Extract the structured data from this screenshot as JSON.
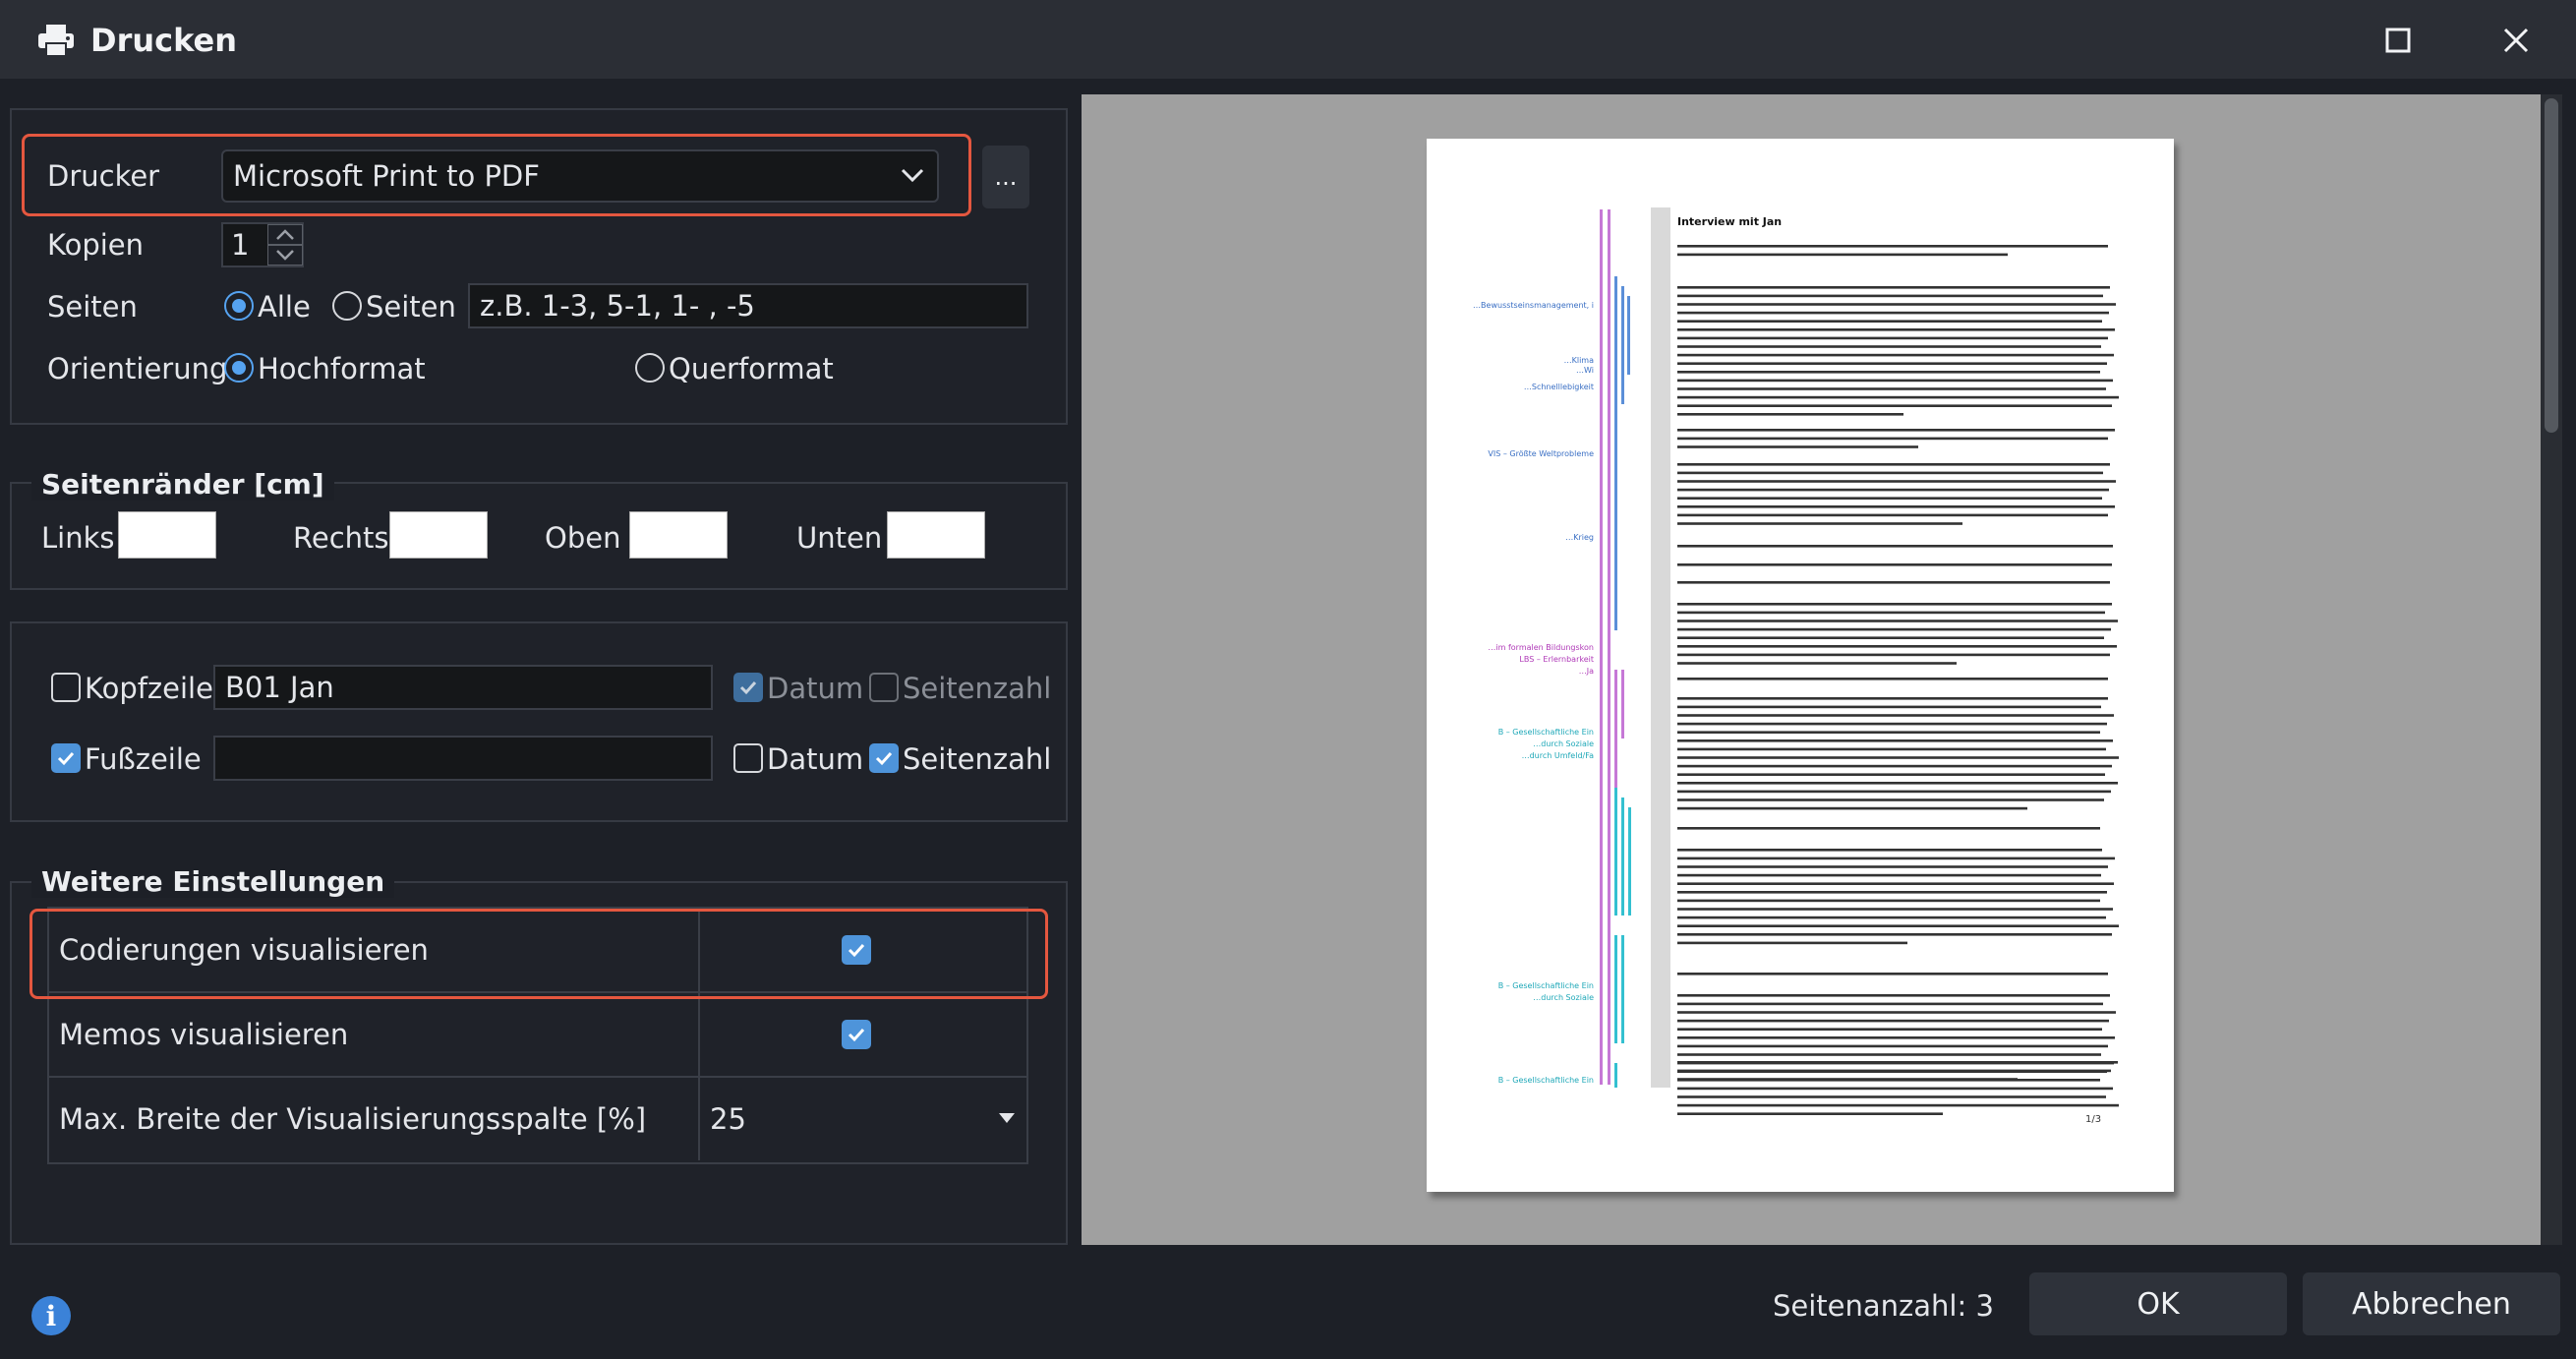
{
  "window": {
    "title": "Drucken",
    "title_icon": "printer-icon",
    "buttons": {
      "maximize_icon": "maximize-icon",
      "close_icon": "close-icon"
    }
  },
  "printer": {
    "label": "Drucker",
    "selected": "Microsoft Print to PDF",
    "more_label": "...",
    "copies_label": "Kopien",
    "copies_value": "1",
    "pages_label": "Seiten",
    "pages_all_label": "Alle",
    "pages_range_label": "Seiten",
    "pages_range_placeholder": "z.B. 1-3, 5-1, 1- , -5",
    "pages_selected": "all",
    "orientation_label": "Orientierung",
    "portrait_label": "Hochformat",
    "landscape_label": "Querformat",
    "orientation_selected": "portrait"
  },
  "margins": {
    "title": "Seitenränder [cm]",
    "left_label": "Links",
    "right_label": "Rechts",
    "top_label": "Oben",
    "bottom_label": "Unten"
  },
  "header_footer": {
    "header_label": "Kopfzeile",
    "header_checked": false,
    "header_value": "B01 Jan",
    "header_date_label": "Datum",
    "header_date_checked": true,
    "header_pagenum_label": "Seitenzahl",
    "header_pagenum_checked": false,
    "footer_label": "Fußzeile",
    "footer_checked": true,
    "footer_value": "",
    "footer_date_label": "Datum",
    "footer_date_checked": false,
    "footer_pagenum_label": "Seitenzahl",
    "footer_pagenum_checked": true
  },
  "settings": {
    "title": "Weitere Einstellungen",
    "rows": [
      {
        "label": "Codierungen visualisieren",
        "checked": true
      },
      {
        "label": "Memos visualisieren",
        "checked": true
      },
      {
        "label": "Max. Breite der Visualisierungsspalte [%]",
        "value": "25"
      }
    ]
  },
  "preview": {
    "page_title": "Interview mit Jan",
    "page_footer": "1/3",
    "code_labels": [
      {
        "text": "…Bewusstseinsmanagement, i",
        "color": "#3a6fc4"
      },
      {
        "text": "…Klima",
        "color": "#3a6fc4"
      },
      {
        "text": "…Wi",
        "color": "#3a6fc4"
      },
      {
        "text": "…Schnelllebigkeit",
        "color": "#3a6fc4"
      },
      {
        "text": "VIS – Größte Weltprobleme",
        "color": "#3a6fc4"
      },
      {
        "text": "…Krieg",
        "color": "#3a6fc4"
      },
      {
        "text": "…im formalen Bildungskon",
        "color": "#b03ab8"
      },
      {
        "text": "LBS – Erlernbarkeit",
        "color": "#b03ab8"
      },
      {
        "text": "…Ja",
        "color": "#b03ab8"
      },
      {
        "text": "B – Gesellschaftliche Ein",
        "color": "#1fa8b8"
      },
      {
        "text": "…durch Soziale",
        "color": "#1fa8b8"
      },
      {
        "text": "…durch Umfeld/Fa",
        "color": "#1fa8b8"
      },
      {
        "text": "B – Gesellschaftliche Ein",
        "color": "#1fa8b8"
      },
      {
        "text": "…durch Soziale",
        "color": "#1fa8b8"
      },
      {
        "text": "B – Gesellschaftliche Ein",
        "color": "#1fa8b8"
      }
    ]
  },
  "footer": {
    "page_count": "Seitenanzahl: 3",
    "ok_label": "OK",
    "cancel_label": "Abbrechen",
    "info_icon": "i"
  },
  "colors": {
    "accent": "#4e94da",
    "highlight": "#e4573f",
    "code_blue": "#3a6fc4",
    "code_purple": "#b03ab8",
    "code_cyan": "#1fa8b8"
  }
}
